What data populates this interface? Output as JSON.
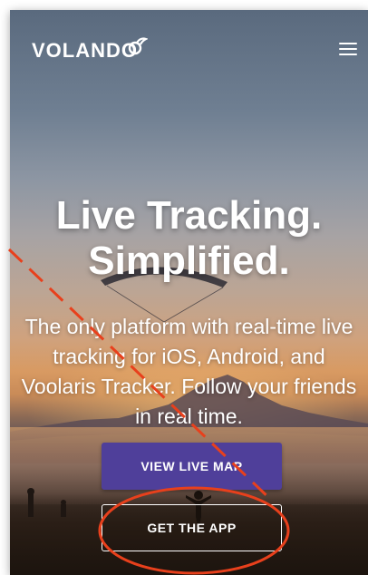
{
  "header": {
    "logo_text": "VOLANDO",
    "menu_icon": "hamburger-menu-icon"
  },
  "hero": {
    "headline_line1": "Live Tracking.",
    "headline_line2": "Simplified.",
    "subtitle_line1": "The only platform with real-time live",
    "subtitle_line2": "tracking for iOS, Android, and",
    "subtitle_line3": "Voolaris Tracker. Follow your friends",
    "subtitle_line4": "in real time."
  },
  "buttons": {
    "view_live_map": "VIEW LIVE MAP",
    "get_the_app": "GET THE APP"
  },
  "colors": {
    "primary_button": "#4f3f9a",
    "annotation": "#e8401c"
  }
}
